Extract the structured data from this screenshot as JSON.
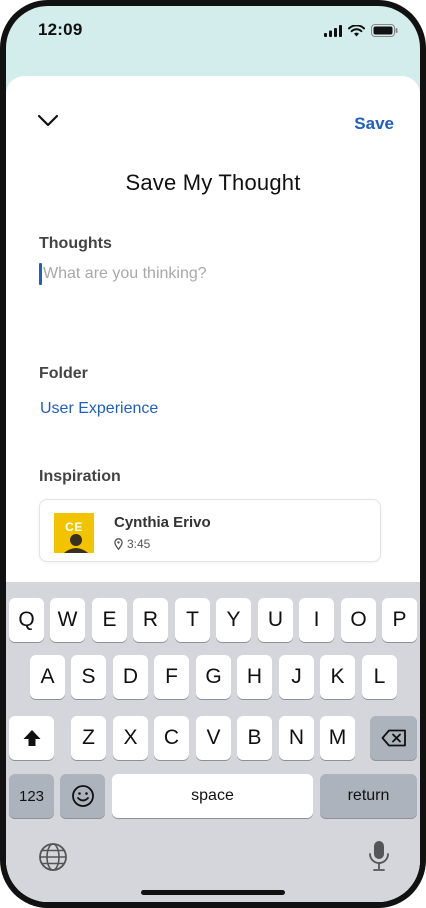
{
  "status_bar": {
    "time": "12:09"
  },
  "sheet": {
    "save_label": "Save",
    "title": "Save My Thought",
    "thoughts": {
      "label": "Thoughts",
      "placeholder": "What are you thinking?"
    },
    "folder": {
      "label": "Folder",
      "value": "User Experience"
    },
    "inspiration": {
      "label": "Inspiration",
      "card": {
        "initials": "CE",
        "name": "Cynthia Erivo",
        "time": "3:45"
      }
    }
  },
  "keyboard": {
    "row1": [
      "Q",
      "W",
      "E",
      "R",
      "T",
      "Y",
      "U",
      "I",
      "O",
      "P"
    ],
    "row2": [
      "A",
      "S",
      "D",
      "F",
      "G",
      "H",
      "J",
      "K",
      "L"
    ],
    "row3": [
      "Z",
      "X",
      "C",
      "V",
      "B",
      "N",
      "M"
    ],
    "numbers_label": "123",
    "space_label": "space",
    "return_label": "return"
  },
  "colors": {
    "accent": "#1f5fbf",
    "avatar_bg": "#f2c400",
    "backdrop": "#d3ecec"
  }
}
